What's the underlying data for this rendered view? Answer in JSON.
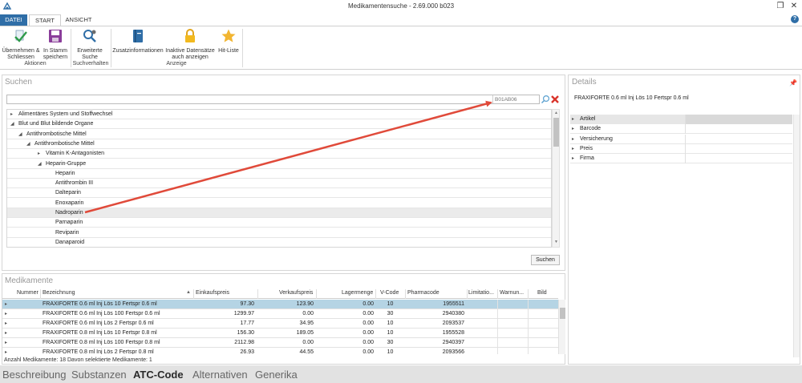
{
  "window": {
    "title": "Medikamentensuche - 2.69.000 b023"
  },
  "ribbon_tabs": [
    {
      "label": "DATEI"
    },
    {
      "label": "START"
    },
    {
      "label": "ANSICHT"
    }
  ],
  "ribbon": {
    "buttons": [
      {
        "label": "Übernehmen &",
        "label2": "Schliessen",
        "icon": "check-accept-icon"
      },
      {
        "label": "In Stamm",
        "label2": "speichern",
        "icon": "save-icon"
      },
      {
        "label": "Erweiterte",
        "label2": "Suche",
        "icon": "advanced-search-icon"
      },
      {
        "label": "Zusatzinformationen",
        "label2": "",
        "icon": "book-icon"
      },
      {
        "label": "Inaktive Datensätze",
        "label2": "auch anzeigen",
        "icon": "lock-icon"
      },
      {
        "label": "Hit-Liste",
        "label2": "",
        "icon": "star-icon"
      }
    ],
    "groups": [
      {
        "label": "Aktionen"
      },
      {
        "label": "Suchverhalten"
      },
      {
        "label": "Anzeige"
      }
    ]
  },
  "search": {
    "panel_title": "Suchen",
    "atc_placeholder": "B01AB06",
    "button_label": "Suchen"
  },
  "tree": [
    {
      "label": "Alimentäres System und Stoffwechsel",
      "level": 0,
      "expander": "collapsed"
    },
    {
      "label": "Blut und Blut bildende Organe",
      "level": 0,
      "expander": "expanded"
    },
    {
      "label": "Antithrombotische Mittel",
      "level": 1,
      "expander": "expanded"
    },
    {
      "label": "Antithrombotische Mittel",
      "level": 2,
      "expander": "expanded"
    },
    {
      "label": "Vitamin K-Antagonisten",
      "level": 3,
      "expander": "collapsed"
    },
    {
      "label": "Heparin-Gruppe",
      "level": 3,
      "expander": "expanded"
    },
    {
      "label": "Heparin",
      "level": 4,
      "expander": "none"
    },
    {
      "label": "Antithrombin III",
      "level": 4,
      "expander": "none"
    },
    {
      "label": "Dalteparin",
      "level": 4,
      "expander": "none"
    },
    {
      "label": "Enoxaparin",
      "level": 4,
      "expander": "none"
    },
    {
      "label": "Nadroparin",
      "level": 4,
      "expander": "none",
      "selected": true
    },
    {
      "label": "Parnaparin",
      "level": 4,
      "expander": "none"
    },
    {
      "label": "Reviparin",
      "level": 4,
      "expander": "none"
    },
    {
      "label": "Danaparoid",
      "level": 4,
      "expander": "none"
    }
  ],
  "medikamente": {
    "panel_title": "Medikamente",
    "columns": [
      "Nummer",
      "Bezeichnung",
      "Einkaufspreis",
      "Verkaufspreis",
      "Lagermenge",
      "V-Code",
      "Pharmacode",
      "Limitatio...",
      "Warnun...",
      "Bild"
    ],
    "rows": [
      {
        "bezeichnung": "FRAXIFORTE 0.6 ml Inj Lös 10 Fertspr 0.6 ml",
        "einkauf": "97.30",
        "verkauf": "123.90",
        "lager": "0.00",
        "vcode": "10",
        "pharmacode": "1955511",
        "selected": true
      },
      {
        "bezeichnung": "FRAXIFORTE 0.6 ml Inj Lös 100 Fertspr 0.6 ml",
        "einkauf": "1299.97",
        "verkauf": "0.00",
        "lager": "0.00",
        "vcode": "30",
        "pharmacode": "2940380"
      },
      {
        "bezeichnung": "FRAXIFORTE 0.6 ml Inj Lös 2 Fertspr 0.6 ml",
        "einkauf": "17.77",
        "verkauf": "34.95",
        "lager": "0.00",
        "vcode": "10",
        "pharmacode": "2093537"
      },
      {
        "bezeichnung": "FRAXIFORTE 0.8 ml Inj Lös 10 Fertspr 0.8 ml",
        "einkauf": "156.30",
        "verkauf": "189.05",
        "lager": "0.00",
        "vcode": "10",
        "pharmacode": "1955528"
      },
      {
        "bezeichnung": "FRAXIFORTE 0.8 ml Inj Lös 100 Fertspr 0.8 ml",
        "einkauf": "2112.98",
        "verkauf": "0.00",
        "lager": "0.00",
        "vcode": "30",
        "pharmacode": "2940397"
      },
      {
        "bezeichnung": "FRAXIFORTE 0.8 ml Inj Lös 2 Fertspr 0.8 ml",
        "einkauf": "26.93",
        "verkauf": "44.55",
        "lager": "0.00",
        "vcode": "10",
        "pharmacode": "2093566"
      }
    ],
    "status": "Anzahl Medikamente: 18   Davon selektierte Medikamente: 1"
  },
  "details": {
    "panel_title": "Details",
    "product_title": "FRAXIFORTE 0.6 ml Inj Lös 10 Fertspr 0.6 ml",
    "rows": [
      {
        "label": "Artikel"
      },
      {
        "label": "Barcode"
      },
      {
        "label": "Versicherung"
      },
      {
        "label": "Preis"
      },
      {
        "label": "Firma"
      }
    ]
  },
  "bottom_tabs": [
    {
      "label": "Beschreibung",
      "active": false
    },
    {
      "label": "Substanzen",
      "active": false
    },
    {
      "label": "ATC-Code",
      "active": true
    },
    {
      "label": "Alternativen",
      "active": false
    },
    {
      "label": "Generika",
      "active": false
    }
  ],
  "colors": {
    "accent": "#2f6ea7",
    "selection": "#b5d4e4",
    "annotation_arrow": "#e04a3a",
    "clear_icon": "#d9342b"
  }
}
